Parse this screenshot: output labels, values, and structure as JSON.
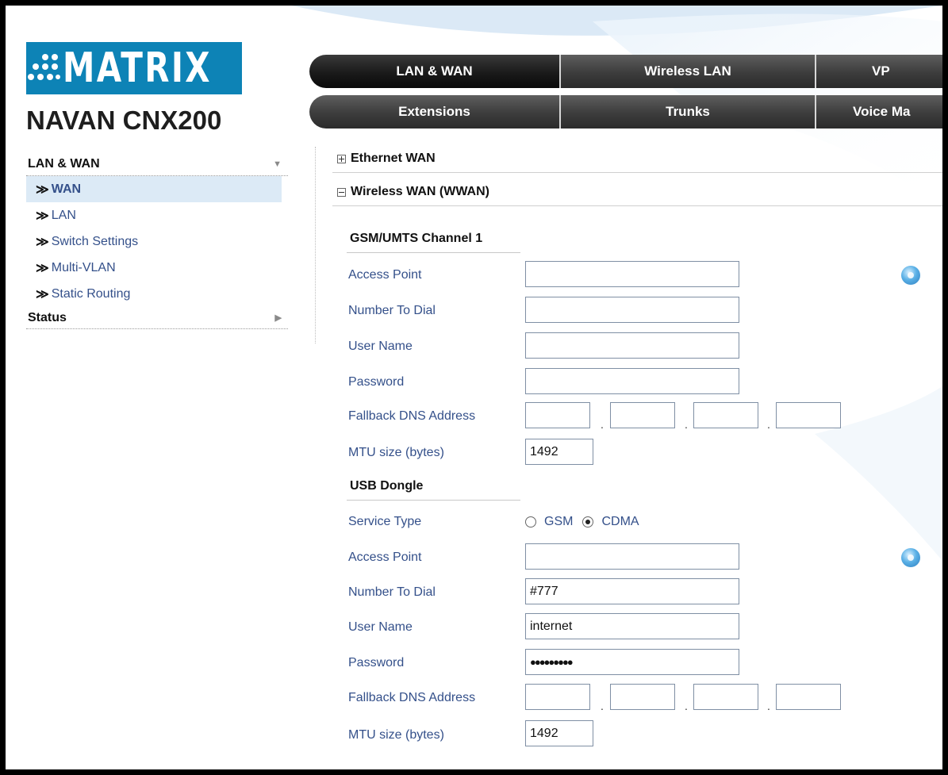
{
  "brand": {
    "logo_text": "MATRIX",
    "product": "NAVAN CNX200",
    "logo_color": "#0d83b6"
  },
  "nav": {
    "row1": [
      "LAN & WAN",
      "Wireless LAN",
      "VP"
    ],
    "row2": [
      "Extensions",
      "Trunks",
      "Voice Ma"
    ]
  },
  "sidebar": {
    "section_lan": "LAN & WAN",
    "items": [
      "WAN",
      "LAN",
      "Switch Settings",
      "Multi-VLAN",
      "Static Routing"
    ],
    "section_status": "Status",
    "arrow_down": "▼",
    "arrow_right": "▶",
    "chevron": "≫"
  },
  "sections": {
    "ethernet": "Ethernet WAN",
    "wwan": "Wireless WAN (WWAN)"
  },
  "gsm": {
    "title": "GSM/UMTS Channel 1",
    "labels": [
      "Access Point",
      "Number To Dial",
      "User Name",
      "Password",
      "Fallback DNS Address",
      "MTU size (bytes)"
    ],
    "access_point": "",
    "number_to_dial": "",
    "user_name": "",
    "password": "",
    "mtu": "1492"
  },
  "usb": {
    "title": "USB Dongle",
    "service_type_label": "Service Type",
    "options": [
      "GSM",
      "CDMA"
    ],
    "selected": "CDMA",
    "labels": [
      "Access Point",
      "Number To Dial",
      "User Name",
      "Password",
      "Fallback DNS Address",
      "MTU size (bytes)"
    ],
    "access_point": "",
    "number_to_dial": "#777",
    "user_name": "internet",
    "password": "●●●●●●●●●",
    "mtu": "1492"
  },
  "ip_separator": ".",
  "icons": {
    "apply": "settings-gear-icon"
  }
}
